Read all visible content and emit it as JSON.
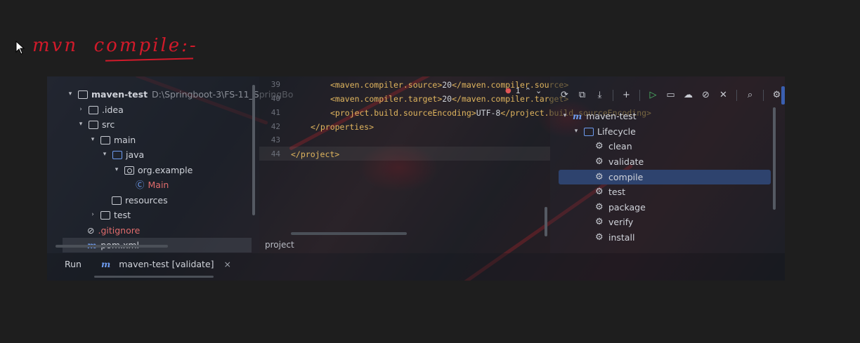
{
  "annotation": {
    "text": "mvn  compile:-",
    "color": "#d11a2a"
  },
  "project_tree": [
    {
      "label": "maven-test",
      "path": "D:\\Springboot-3\\FS-11_SpringBo",
      "kind": "module",
      "expanded": true
    },
    {
      "label": ".idea",
      "kind": "folder",
      "expanded": false
    },
    {
      "label": "src",
      "kind": "folder",
      "expanded": true
    },
    {
      "label": "main",
      "kind": "folder",
      "expanded": true
    },
    {
      "label": "java",
      "kind": "source-folder",
      "expanded": true
    },
    {
      "label": "org.example",
      "kind": "package",
      "expanded": true
    },
    {
      "label": "Main",
      "kind": "class"
    },
    {
      "label": "resources",
      "kind": "resources-folder"
    },
    {
      "label": "test",
      "kind": "folder",
      "expanded": false
    },
    {
      "label": ".gitignore",
      "kind": "ignored-file"
    },
    {
      "label": "pom.xml",
      "kind": "maven-file"
    }
  ],
  "editor": {
    "line_numbers": [
      "39",
      "40",
      "41",
      "42",
      "43",
      "44"
    ],
    "lines": [
      {
        "tag_open": "<maven.compiler.source>",
        "text": "20",
        "tag_close": "</maven.compiler.source>"
      },
      {
        "tag_open": "<maven.compiler.target>",
        "text": "20",
        "tag_close": "</maven.compiler.target>"
      },
      {
        "tag_open": "<project.build.sourceEncoding>",
        "text": "UTF-8",
        "tag_close": "</project.build.sourceEncoding>"
      },
      {
        "tag_open": "</properties>",
        "text": "",
        "tag_close": ""
      },
      {
        "tag_open": "",
        "text": "",
        "tag_close": ""
      },
      {
        "tag_open": "</project>",
        "text": "",
        "tag_close": ""
      }
    ],
    "inspection_count": "1",
    "breadcrumb": "project"
  },
  "maven_panel": {
    "toolbar_icons": [
      "reload-icon",
      "generate-sources-icon",
      "download-icon",
      "add-icon",
      "run-icon",
      "execute-goal-icon",
      "offline-icon",
      "skip-tests-icon",
      "collapse-icon",
      "analyze-dependencies-icon",
      "settings-icon"
    ],
    "project": "maven-test",
    "lifecycle_label": "Lifecycle",
    "goals": [
      "clean",
      "validate",
      "compile",
      "test",
      "package",
      "verify",
      "install"
    ],
    "selected_goal": "compile"
  },
  "run_bar": {
    "title": "Run",
    "tab_label": "maven-test [validate]",
    "close_symbol": "×"
  },
  "colors": {
    "accent_blue": "#6e9cf0",
    "selection": "#2e436e",
    "error_red": "#e06c6c",
    "run_green": "#4fbf6b"
  }
}
